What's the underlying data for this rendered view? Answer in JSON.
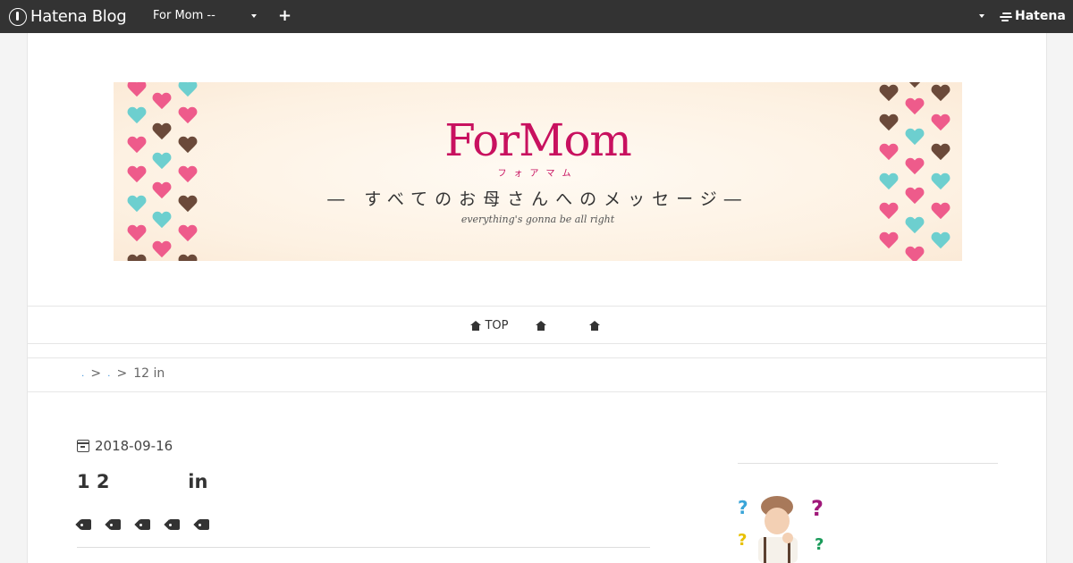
{
  "topbar": {
    "brand": "Hatena Blog",
    "blog_selector": "For Mom --",
    "add_label": "+",
    "account_label": "Hatena"
  },
  "banner": {
    "title": "ForMom",
    "kana": "フォアマム",
    "message": "― すべてのお母さんへのメッセージ―",
    "subtitle": "everything's gonna be all right",
    "colors": {
      "pink": "#ee5b8b",
      "teal": "#6dcfcf",
      "brown": "#6b4a3a"
    }
  },
  "gnav": {
    "items": [
      {
        "label": "TOP",
        "icon": "home-icon"
      },
      {
        "label": "",
        "icon": "home-icon"
      },
      {
        "label": "",
        "icon": "home-icon"
      }
    ]
  },
  "breadcrumb": {
    "sep": ">",
    "current": "12 in"
  },
  "entry": {
    "date": "2018-09-16",
    "title": "1 2            in",
    "tag_count_icons": 5
  },
  "colors": {
    "topbar_bg": "#333333",
    "accent": "#c8115f",
    "link": "#3a8fd8"
  }
}
